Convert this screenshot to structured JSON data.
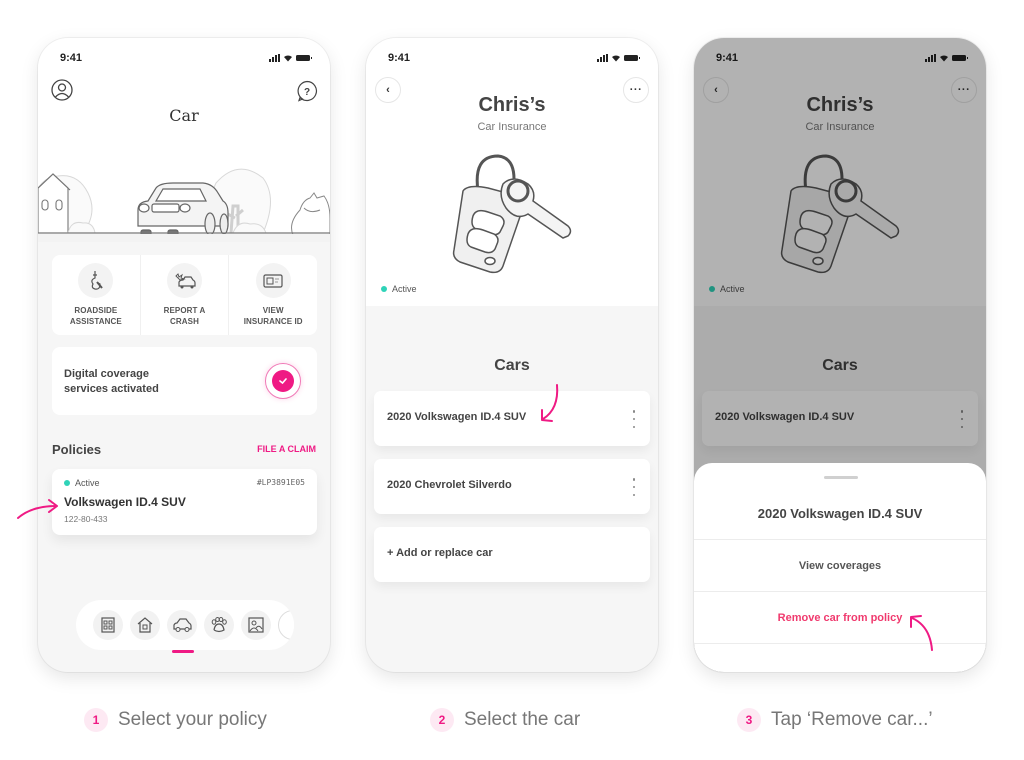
{
  "colors": {
    "accent": "#ef1a84",
    "active_dot": "#2fd3b8",
    "danger": "#f03a6e"
  },
  "status_bar": {
    "time": "9:41",
    "icons": [
      "cellular-signal-icon",
      "wifi-icon",
      "battery-icon"
    ]
  },
  "screen1": {
    "title": "Car",
    "top_left_icon": "profile-icon",
    "top_right_icon": "help-icon",
    "illustration": "car-scene-illustration",
    "quick_actions": [
      {
        "label": "ROADSIDE\nASSISTANCE",
        "icon": "tow-hook-icon"
      },
      {
        "label": "REPORT A\nCRASH",
        "icon": "car-crash-icon"
      },
      {
        "label": "VIEW\nINSURANCE ID",
        "icon": "id-card-icon"
      }
    ],
    "coverage": {
      "text": "Digital coverage\nservices activated",
      "icon": "check-icon"
    },
    "policies_heading": "Policies",
    "file_claim": "FILE A CLAIM",
    "policy": {
      "status": "Active",
      "id": "#LP3891E05",
      "name": "Volkswagen ID.4 SUV",
      "number": "122-80-433"
    },
    "nav": [
      {
        "name": "apartment",
        "icon": "building-icon"
      },
      {
        "name": "home",
        "icon": "house-icon"
      },
      {
        "name": "car",
        "icon": "car-icon",
        "active": true
      },
      {
        "name": "pet",
        "icon": "paw-icon"
      },
      {
        "name": "life",
        "icon": "portrait-icon"
      }
    ]
  },
  "screen2": {
    "title": "Chris’s",
    "subtitle": "Car Insurance",
    "status": "Active",
    "cars_heading": "Cars",
    "cars": [
      {
        "name": "2020 Volkswagen ID.4 SUV"
      },
      {
        "name": "2020 Chevrolet Silverdo"
      }
    ],
    "add_car": "+  Add or replace car"
  },
  "screen3": {
    "title": "Chris’s",
    "subtitle": "Car Insurance",
    "status": "Active",
    "cars_heading": "Cars",
    "car": "2020 Volkswagen ID.4 SUV",
    "sheet": {
      "title": "2020 Volkswagen ID.4 SUV",
      "view_coverages": "View coverages",
      "remove": "Remove car from policy"
    }
  },
  "steps": [
    {
      "num": "1",
      "label": "Select your policy"
    },
    {
      "num": "2",
      "label": "Select the car"
    },
    {
      "num": "3",
      "label": "Tap ‘Remove car...’"
    }
  ]
}
